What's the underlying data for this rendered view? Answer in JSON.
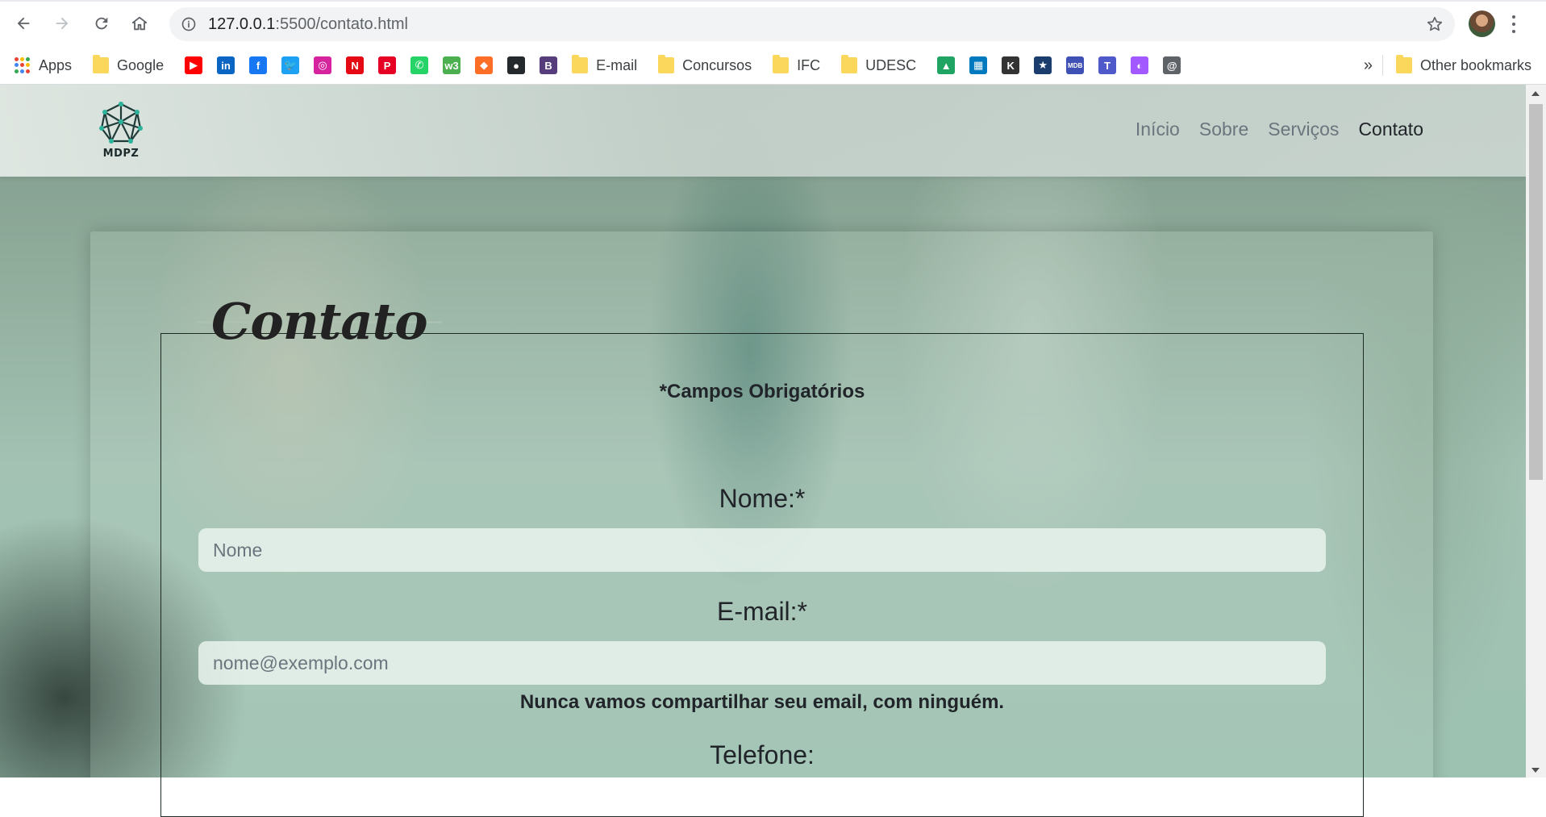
{
  "browser": {
    "url_host": "127.0.0.1",
    "url_rest": ":5500/contato.html",
    "bookmarks": [
      {
        "type": "apps",
        "label": "Apps"
      },
      {
        "type": "folder",
        "label": "Google"
      },
      {
        "type": "icon",
        "icon": "youtube-icon",
        "color": "#ff0000",
        "glyph": "▶"
      },
      {
        "type": "icon",
        "icon": "linkedin-icon",
        "color": "#0a66c2",
        "glyph": "in"
      },
      {
        "type": "icon",
        "icon": "facebook-icon",
        "color": "#1877f2",
        "glyph": "f"
      },
      {
        "type": "icon",
        "icon": "twitter-icon",
        "color": "#1da1f2",
        "glyph": "🐦"
      },
      {
        "type": "icon",
        "icon": "instagram-icon",
        "color": "#d6249f",
        "glyph": "◎"
      },
      {
        "type": "icon",
        "icon": "netflix-icon",
        "color": "#e50914",
        "glyph": "N"
      },
      {
        "type": "icon",
        "icon": "pinterest-icon",
        "color": "#e60023",
        "glyph": "P"
      },
      {
        "type": "icon",
        "icon": "whatsapp-icon",
        "color": "#25d366",
        "glyph": "✆"
      },
      {
        "type": "icon",
        "icon": "w3schools-icon",
        "color": "#4caf50",
        "glyph": "w3"
      },
      {
        "type": "icon",
        "icon": "gitlab-icon",
        "color": "#fc6d26",
        "glyph": "◆"
      },
      {
        "type": "icon",
        "icon": "github-icon",
        "color": "#24292e",
        "glyph": "●"
      },
      {
        "type": "icon",
        "icon": "bootstrap-icon",
        "color": "#563d7c",
        "glyph": "B"
      },
      {
        "type": "folder",
        "label": "E-mail"
      },
      {
        "type": "folder",
        "label": "Concursos"
      },
      {
        "type": "folder",
        "label": "IFC"
      },
      {
        "type": "folder",
        "label": "UDESC"
      },
      {
        "type": "icon",
        "icon": "google-drive-icon",
        "color": "#1fa463",
        "glyph": "▲"
      },
      {
        "type": "icon",
        "icon": "trello-icon",
        "color": "#0079bf",
        "glyph": "▦"
      },
      {
        "type": "icon",
        "icon": "kahoot-icon",
        "color": "#333333",
        "glyph": "K"
      },
      {
        "type": "icon",
        "icon": "star-badge-icon",
        "color": "#1a3d6e",
        "glyph": "★"
      },
      {
        "type": "icon",
        "icon": "mdb-icon",
        "color": "#3f51b5",
        "glyph": "MDB"
      },
      {
        "type": "icon",
        "icon": "teams-icon",
        "color": "#5059c9",
        "glyph": "T"
      },
      {
        "type": "icon",
        "icon": "figma-icon",
        "color": "#a259ff",
        "glyph": "◐"
      },
      {
        "type": "icon",
        "icon": "at-sign-icon",
        "color": "#5f6368",
        "glyph": "@"
      }
    ],
    "overflow_label": "»",
    "other_bookmarks": "Other bookmarks"
  },
  "site": {
    "logo_text": "MDPZ",
    "nav": [
      {
        "label": "Início",
        "active": false
      },
      {
        "label": "Sobre",
        "active": false
      },
      {
        "label": "Serviços",
        "active": false
      },
      {
        "label": "Contato",
        "active": true
      }
    ]
  },
  "form": {
    "legend": "Contato",
    "required_note": "*Campos Obrigatórios",
    "name_label": "Nome:*",
    "name_placeholder": "Nome",
    "email_label": "E-mail:*",
    "email_placeholder": "nome@exemplo.com",
    "email_help": "Nunca vamos compartilhar seu email, com ninguém.",
    "phone_label": "Telefone:"
  }
}
